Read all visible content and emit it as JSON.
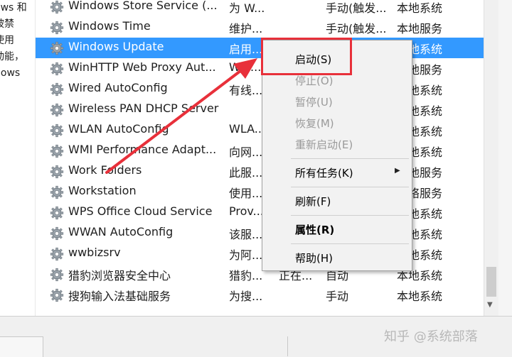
{
  "description_panel": {
    "lines": [
      "ows 和",
      "被禁",
      "使用",
      "动能，",
      "dows"
    ]
  },
  "services": [
    {
      "name": "Windows Store Service (...",
      "desc": "为 W...",
      "status": "",
      "startup": "手动(触发...",
      "logon": "本地系统"
    },
    {
      "name": "Windows Time",
      "desc": "维护...",
      "status": "",
      "startup": "手动(触发...",
      "logon": "本地服务"
    },
    {
      "name": "Windows Update",
      "desc": "启用...",
      "status": "",
      "startup": "手动(触发...",
      "logon": "本地系统",
      "selected": true
    },
    {
      "name": "WinHTTP Web Proxy Aut...",
      "desc": "Win...",
      "status": "",
      "startup": "",
      "logon": "本地服务"
    },
    {
      "name": "Wired AutoConfig",
      "desc": "有线...",
      "status": "",
      "startup": "",
      "logon": "本地系统"
    },
    {
      "name": "Wireless PAN DHCP Server",
      "desc": "",
      "status": "",
      "startup": "",
      "logon": "本地系统"
    },
    {
      "name": "WLAN AutoConfig",
      "desc": "WLA...",
      "status": "",
      "startup": "",
      "logon": "本地系统"
    },
    {
      "name": "WMI Performance Adapt...",
      "desc": "向网...",
      "status": "",
      "startup": "",
      "logon": "本地系统"
    },
    {
      "name": "Work Folders",
      "desc": "此服...",
      "status": "",
      "startup": "",
      "logon": "本地服务"
    },
    {
      "name": "Workstation",
      "desc": "使用...",
      "status": "",
      "startup": "",
      "logon": "网络服务"
    },
    {
      "name": "WPS Office Cloud Service",
      "desc": "Prov...",
      "status": "",
      "startup": "",
      "logon": "本地系统"
    },
    {
      "name": "WWAN AutoConfig",
      "desc": "该服...",
      "status": "",
      "startup": "",
      "logon": "本地系统"
    },
    {
      "name": "wwbizsrv",
      "desc": "为阿...",
      "status": "",
      "startup": "",
      "logon": "本地系统"
    },
    {
      "name": "猎豹浏览器安全中心",
      "desc": "猎豹...",
      "status": "正在...",
      "startup": "自动",
      "logon": "本地系统"
    },
    {
      "name": "搜狗输入法基础服务",
      "desc": "为搜...",
      "status": "",
      "startup": "手动",
      "logon": "本地系统"
    }
  ],
  "context_menu": {
    "start": "启动(S)",
    "stop": "停止(O)",
    "pause": "暂停(U)",
    "resume": "恢复(M)",
    "restart": "重新启动(E)",
    "all_tasks": "所有任务(K)",
    "refresh": "刷新(F)",
    "properties": "属性(R)",
    "help": "帮助(H)"
  },
  "watermark": "知乎 @系统部落",
  "colors": {
    "selection": "#3399ff",
    "annotation": "#e8303a"
  }
}
